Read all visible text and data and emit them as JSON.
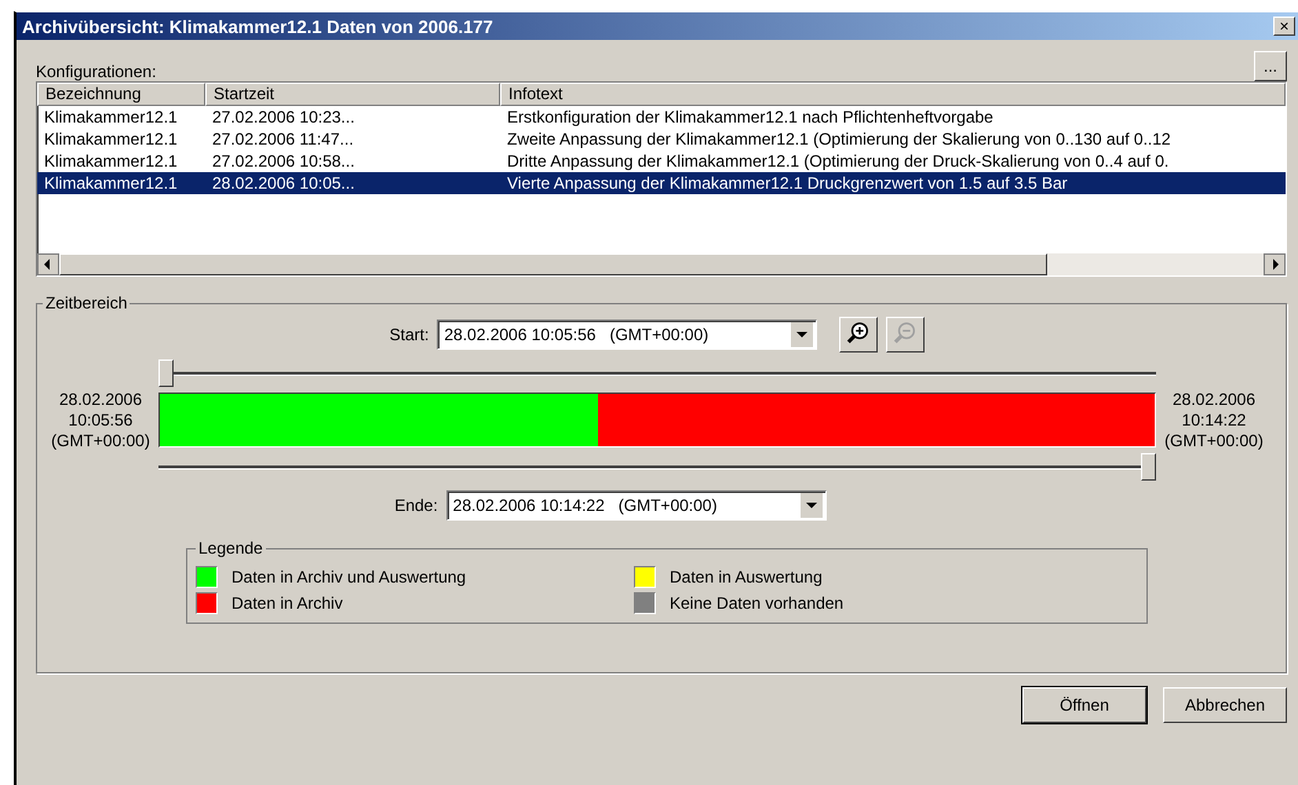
{
  "window": {
    "title": "Archivübersicht: Klimakammer12.1 Daten von 2006.177",
    "close": "×"
  },
  "configurations": {
    "label": "Konfigurationen:",
    "more_button": "...",
    "columns": [
      "Bezeichnung",
      "Startzeit",
      "Infotext"
    ],
    "rows": [
      {
        "cells": [
          "Klimakammer12.1",
          "27.02.2006 10:23...",
          "Erstkonfiguration der Klimakammer12.1 nach Pflichtenheftvorgabe"
        ],
        "selected": false
      },
      {
        "cells": [
          "Klimakammer12.1",
          "27.02.2006 11:47...",
          "Zweite Anpassung der Klimakammer12.1 (Optimierung der Skalierung von 0..130 auf 0..12"
        ],
        "selected": false
      },
      {
        "cells": [
          "Klimakammer12.1",
          "27.02.2006 10:58...",
          "Dritte Anpassung der Klimakammer12.1 (Optimierung der Druck-Skalierung von 0..4 auf 0."
        ],
        "selected": false
      },
      {
        "cells": [
          "Klimakammer12.1",
          "28.02.2006 10:05...",
          "Vierte Anpassung der Klimakammer12.1 Druckgrenzwert von 1.5 auf 3.5 Bar"
        ],
        "selected": true
      }
    ]
  },
  "time_range": {
    "title": "Zeitbereich",
    "start": {
      "label": "Start:",
      "value": "28.02.2006 10:05:56   (GMT+00:00)"
    },
    "end": {
      "label": "Ende:",
      "value": "28.02.2006 10:14:22   (GMT+00:00)"
    },
    "left_time": [
      "28.02.2006",
      "10:05:56",
      "(GMT+00:00)"
    ],
    "right_time": [
      "28.02.2006",
      "10:14:22",
      "(GMT+00:00)"
    ],
    "start_slider": {
      "level": 0
    },
    "end_slider": {
      "level": 1
    },
    "segments": [
      {
        "color": "#00ff00",
        "level": 0.44
      },
      {
        "color": "#ff0000",
        "level": 0.56
      }
    ],
    "legend": {
      "title": "Legende",
      "items": [
        {
          "label": "Daten in Archiv und Auswertung",
          "color": "#00ff00"
        },
        {
          "label": "Daten in Auswertung",
          "color": "#ffff00"
        },
        {
          "label": "Daten in Archiv",
          "color": "#ff0000"
        },
        {
          "label": "Keine Daten vorhanden",
          "color": "#808080"
        }
      ]
    }
  },
  "buttons": [
    "Öffnen",
    "Abbrechen"
  ]
}
